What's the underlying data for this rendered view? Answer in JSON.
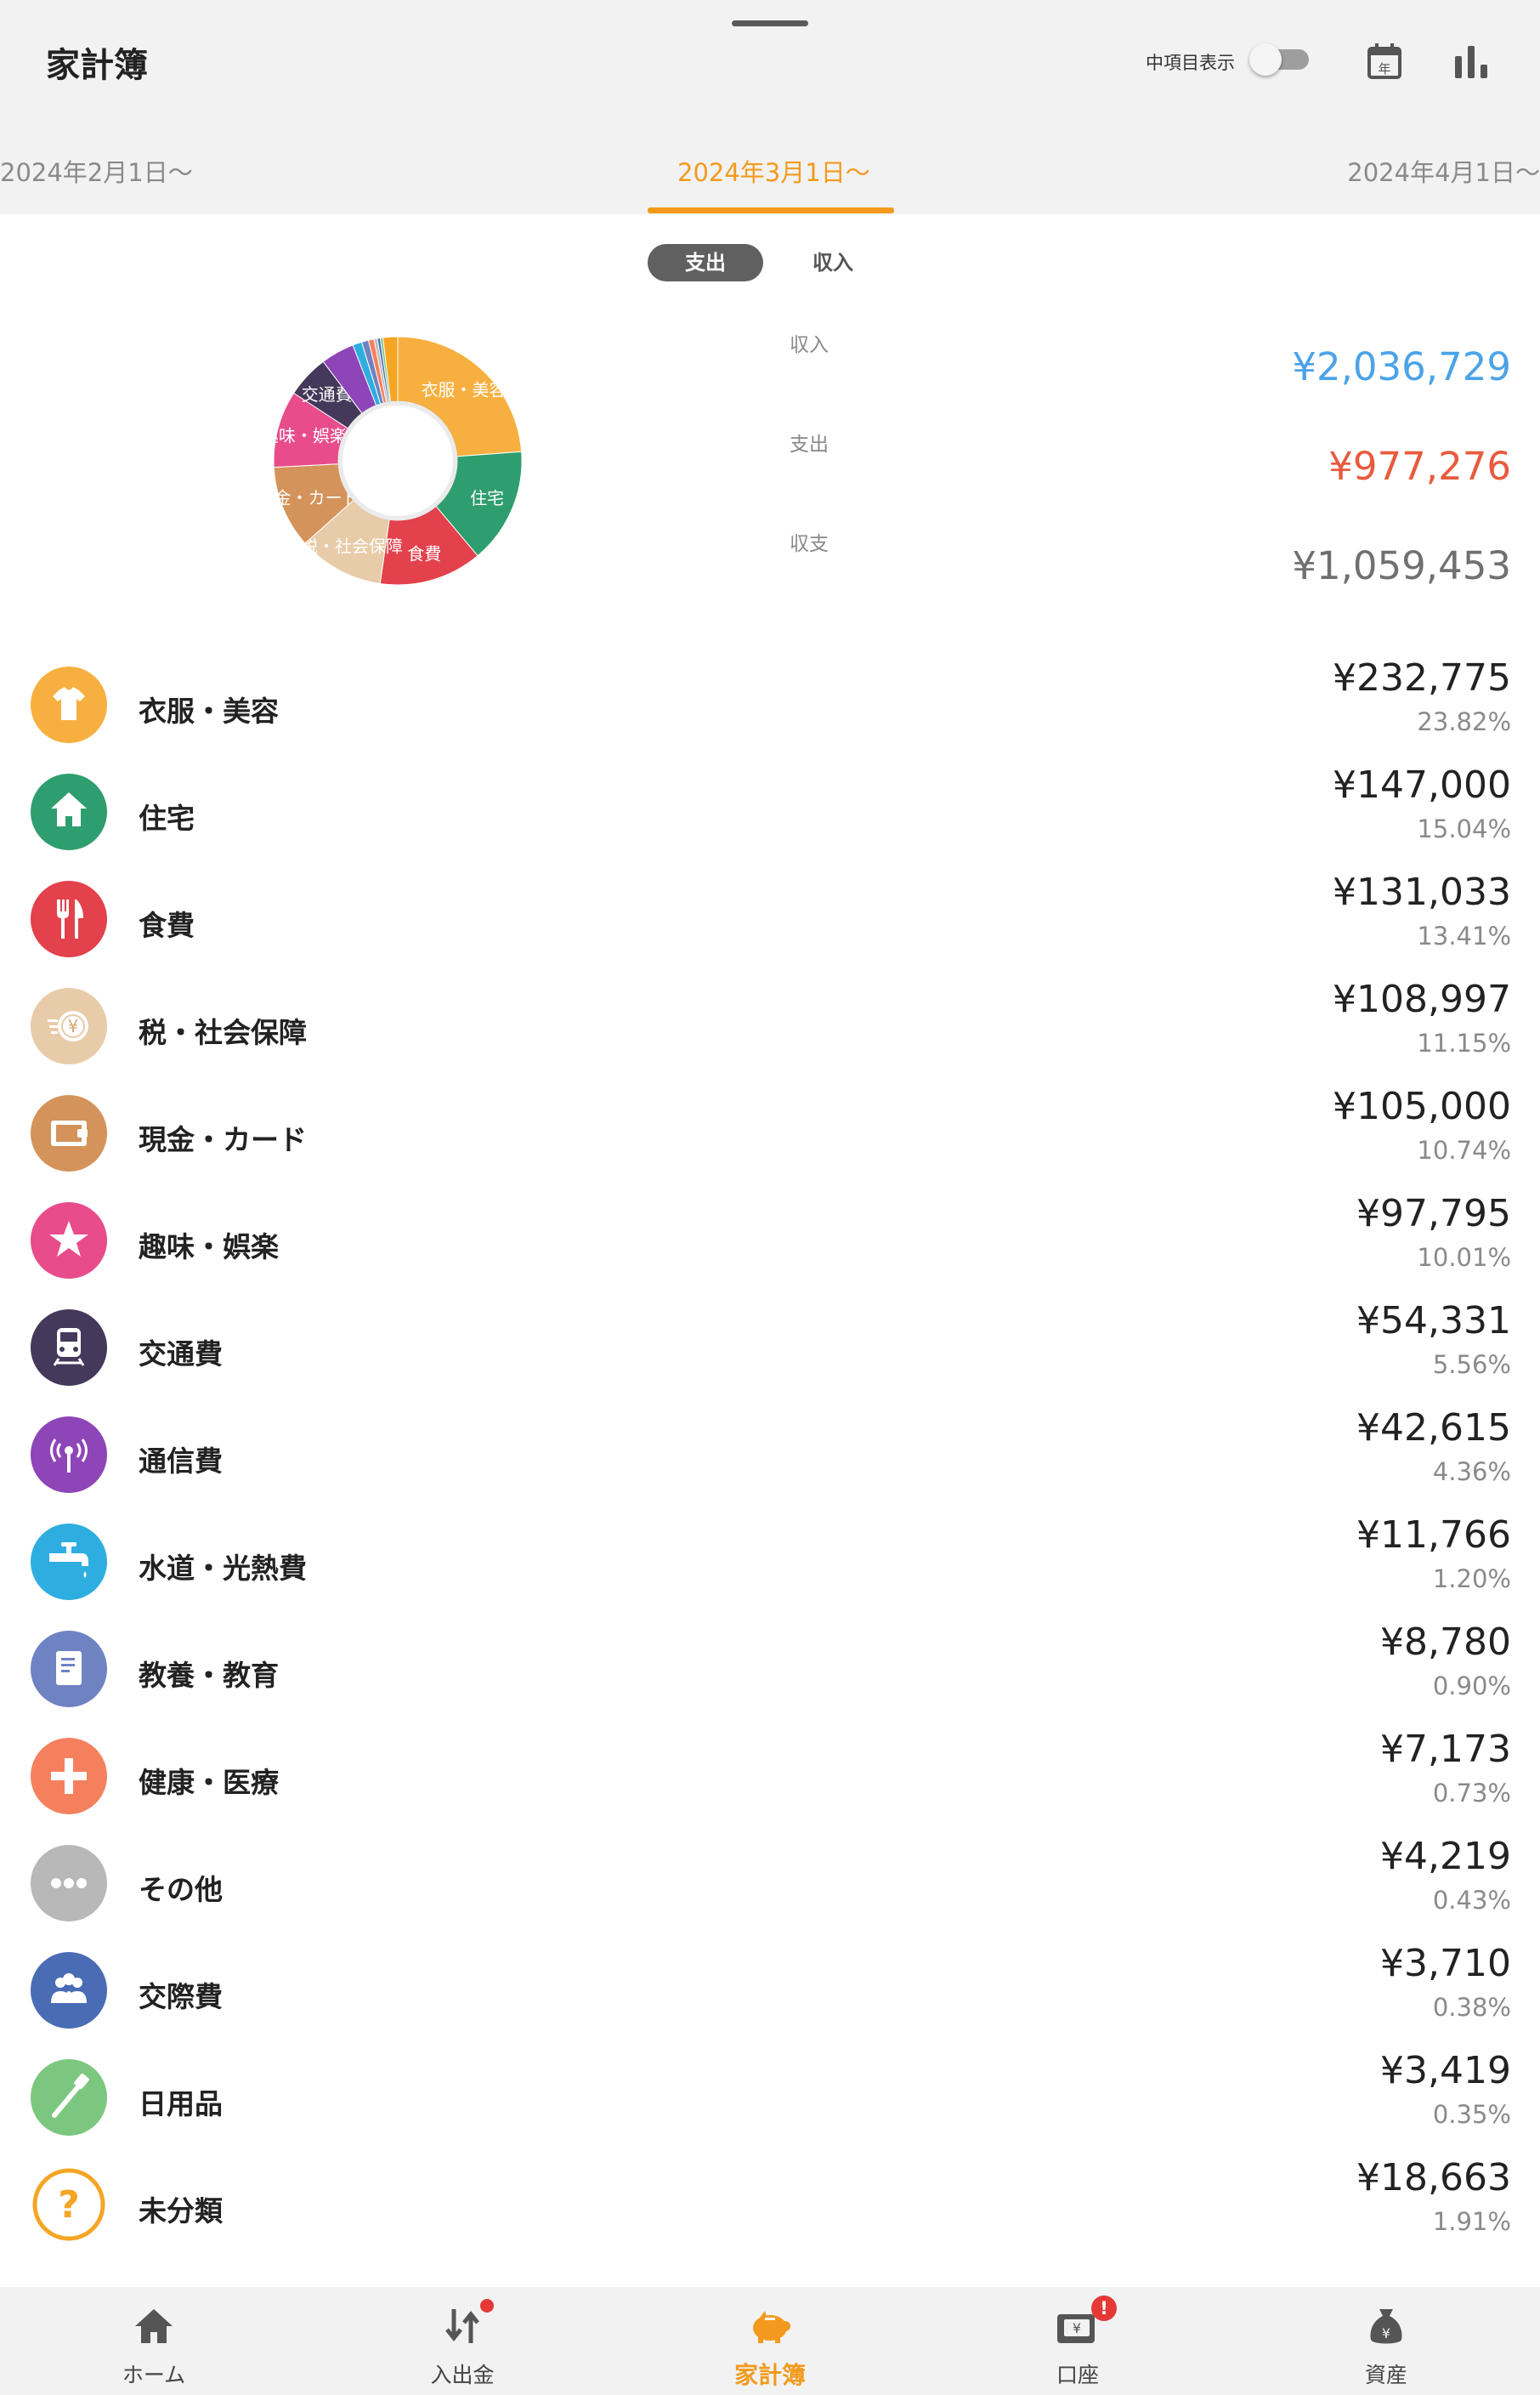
{
  "app": {
    "title": "家計簿"
  },
  "header": {
    "toggle_label": "中項目表示",
    "toggle_on": false,
    "calendar_icon_text": "年"
  },
  "months": {
    "prev": "2024年2月1日〜",
    "current": "2024年3月1日〜",
    "next": "2024年4月1日〜"
  },
  "segment": {
    "active": "支出",
    "inactive": "収入"
  },
  "summary": {
    "income": {
      "label": "収入",
      "value": "¥2,036,729",
      "color": "#4ba3e8"
    },
    "expense": {
      "label": "支出",
      "value": "¥977,276",
      "color": "#e85a3c"
    },
    "balance": {
      "label": "収支",
      "value": "¥1,059,453",
      "color": "#707070"
    }
  },
  "chart_data": {
    "type": "pie",
    "labels": [
      "衣服・美容",
      "住宅",
      "食費",
      "税・社会保障",
      "現金・カード",
      "趣味・娯楽",
      "交通費",
      "通信費",
      "水道・光熱費",
      "教養・教育",
      "健康・医療",
      "その他",
      "交際費",
      "日用品",
      "未分類"
    ],
    "values": [
      23.82,
      15.04,
      13.41,
      11.15,
      10.74,
      10.01,
      5.56,
      4.36,
      1.2,
      0.9,
      0.73,
      0.43,
      0.38,
      0.35,
      1.91
    ],
    "slice_labels": [
      "衣服・美容",
      "住宅",
      "食費",
      "税・社会保障",
      "現金・カード",
      "趣味・娯楽",
      "交通費"
    ],
    "colors": [
      "#f7b040",
      "#2f9e6e",
      "#e3414b",
      "#e8cba8",
      "#d4935a",
      "#e84c8b",
      "#44395a",
      "#8e45b8",
      "#2eaee0",
      "#6f82c2",
      "#f5805e",
      "#b8b8b8",
      "#4a6cb5",
      "#7cc77f",
      "#f5a524"
    ]
  },
  "categories": [
    {
      "name": "衣服・美容",
      "amount": "¥232,775",
      "percent": "23.82%",
      "color": "#f7b040",
      "icon": "tshirt-icon"
    },
    {
      "name": "住宅",
      "amount": "¥147,000",
      "percent": "15.04%",
      "color": "#2f9e6e",
      "icon": "house-icon"
    },
    {
      "name": "食費",
      "amount": "¥131,033",
      "percent": "13.41%",
      "color": "#e3414b",
      "icon": "fork-knife-icon"
    },
    {
      "name": "税・社会保障",
      "amount": "¥108,997",
      "percent": "11.15%",
      "color": "#e8cba8",
      "icon": "yen-coin-icon"
    },
    {
      "name": "現金・カード",
      "amount": "¥105,000",
      "percent": "10.74%",
      "color": "#d4935a",
      "icon": "wallet-icon"
    },
    {
      "name": "趣味・娯楽",
      "amount": "¥97,795",
      "percent": "10.01%",
      "color": "#e84c8b",
      "icon": "star-icon"
    },
    {
      "name": "交通費",
      "amount": "¥54,331",
      "percent": "5.56%",
      "color": "#44395a",
      "icon": "train-icon"
    },
    {
      "name": "通信費",
      "amount": "¥42,615",
      "percent": "4.36%",
      "color": "#8e45b8",
      "icon": "antenna-icon"
    },
    {
      "name": "水道・光熱費",
      "amount": "¥11,766",
      "percent": "1.20%",
      "color": "#2eaee0",
      "icon": "faucet-icon"
    },
    {
      "name": "教養・教育",
      "amount": "¥8,780",
      "percent": "0.90%",
      "color": "#6f82c2",
      "icon": "book-icon"
    },
    {
      "name": "健康・医療",
      "amount": "¥7,173",
      "percent": "0.73%",
      "color": "#f5805e",
      "icon": "medical-cross-icon"
    },
    {
      "name": "その他",
      "amount": "¥4,219",
      "percent": "0.43%",
      "color": "#b8b8b8",
      "icon": "more-dots-icon"
    },
    {
      "name": "交際費",
      "amount": "¥3,710",
      "percent": "0.38%",
      "color": "#4a6cb5",
      "icon": "people-icon"
    },
    {
      "name": "日用品",
      "amount": "¥3,419",
      "percent": "0.35%",
      "color": "#7cc77f",
      "icon": "toothbrush-icon"
    },
    {
      "name": "未分類",
      "amount": "¥18,663",
      "percent": "1.91%",
      "color": "#f5a524",
      "icon": "question-icon"
    }
  ],
  "bottom_nav": {
    "items": [
      {
        "label": "ホーム",
        "icon": "home-icon",
        "active": false
      },
      {
        "label": "入出金",
        "icon": "transfer-arrows-icon",
        "active": false,
        "badge": "dot"
      },
      {
        "label": "家計簿",
        "icon": "piggy-bank-icon",
        "active": true
      },
      {
        "label": "口座",
        "icon": "account-wallet-icon",
        "active": false,
        "badge": "!"
      },
      {
        "label": "資産",
        "icon": "money-bag-icon",
        "active": false
      }
    ],
    "active_color": "#f39a1e"
  }
}
